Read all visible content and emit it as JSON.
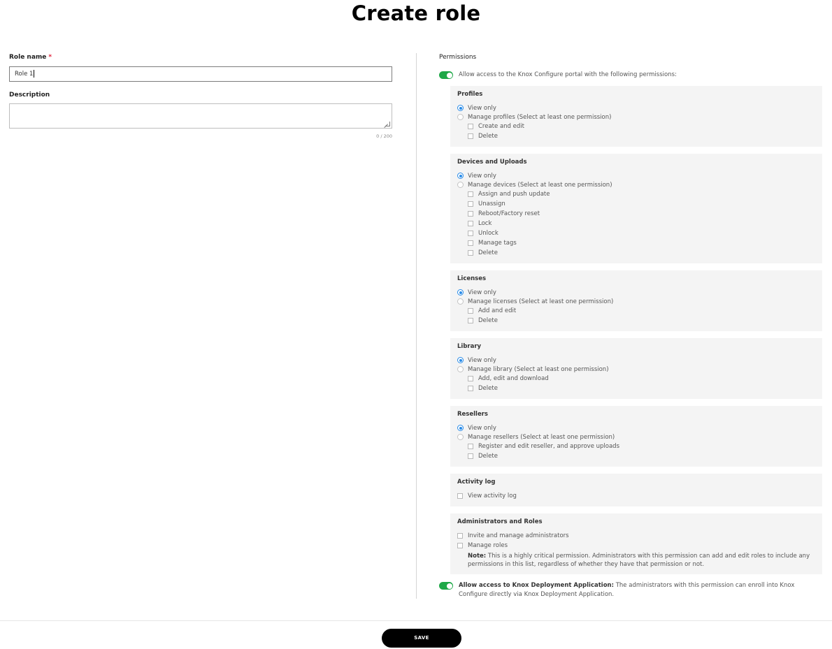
{
  "page": {
    "title": "Create role"
  },
  "form": {
    "role_name_label": "Role name",
    "required_mark": "*",
    "role_name_value": "Role 1",
    "description_label": "Description",
    "description_value": "",
    "char_count": "0 / 200"
  },
  "permissions": {
    "title": "Permissions",
    "portal_toggle": {
      "label": "Allow access to the Knox Configure portal with the following permissions:",
      "on": true
    },
    "sections": [
      {
        "title": "Profiles",
        "view_only": "View only",
        "manage": "Manage profiles (Select at least one permission)",
        "selected": "view_only",
        "checks": [
          "Create and edit",
          "Delete"
        ]
      },
      {
        "title": "Devices and Uploads",
        "view_only": "View only",
        "manage": "Manage devices (Select at least one permission)",
        "selected": "view_only",
        "checks": [
          "Assign and push update",
          "Unassign",
          "Reboot/Factory reset",
          "Lock",
          "Unlock",
          "Manage tags",
          "Delete"
        ]
      },
      {
        "title": "Licenses",
        "view_only": "View only",
        "manage": "Manage licenses (Select at least one permission)",
        "selected": "view_only",
        "checks": [
          "Add and edit",
          "Delete"
        ]
      },
      {
        "title": "Library",
        "view_only": "View only",
        "manage": "Manage library (Select at least one permission)",
        "selected": "view_only",
        "checks": [
          "Add, edit and download",
          "Delete"
        ]
      },
      {
        "title": "Resellers",
        "view_only": "View only",
        "manage": "Manage resellers (Select at least one permission)",
        "selected": "view_only",
        "checks": [
          "Register and edit reseller, and approve uploads",
          "Delete"
        ]
      }
    ],
    "activity_log": {
      "title": "Activity log",
      "checks": [
        "View activity log"
      ]
    },
    "admins_roles": {
      "title": "Administrators and Roles",
      "checks": [
        "Invite and manage administrators",
        "Manage roles"
      ],
      "note_label": "Note:",
      "note_text": "This is a highly critical permission. Administrators with this permission can add and edit roles to include any permissions in this list, regardless of whether they have that permission or not."
    },
    "kda_toggle": {
      "label_bold": "Allow access to Knox Deployment Application:",
      "label_rest": "The administrators with this permission can enroll into Knox Configure directly via Knox Deployment Application.",
      "on": true
    }
  },
  "footer": {
    "save_label": "SAVE"
  },
  "colors": {
    "toggle_on": "#1ea847",
    "radio_selected": "#2a8ce8",
    "required": "#e0233b",
    "save_bg": "#000000"
  }
}
